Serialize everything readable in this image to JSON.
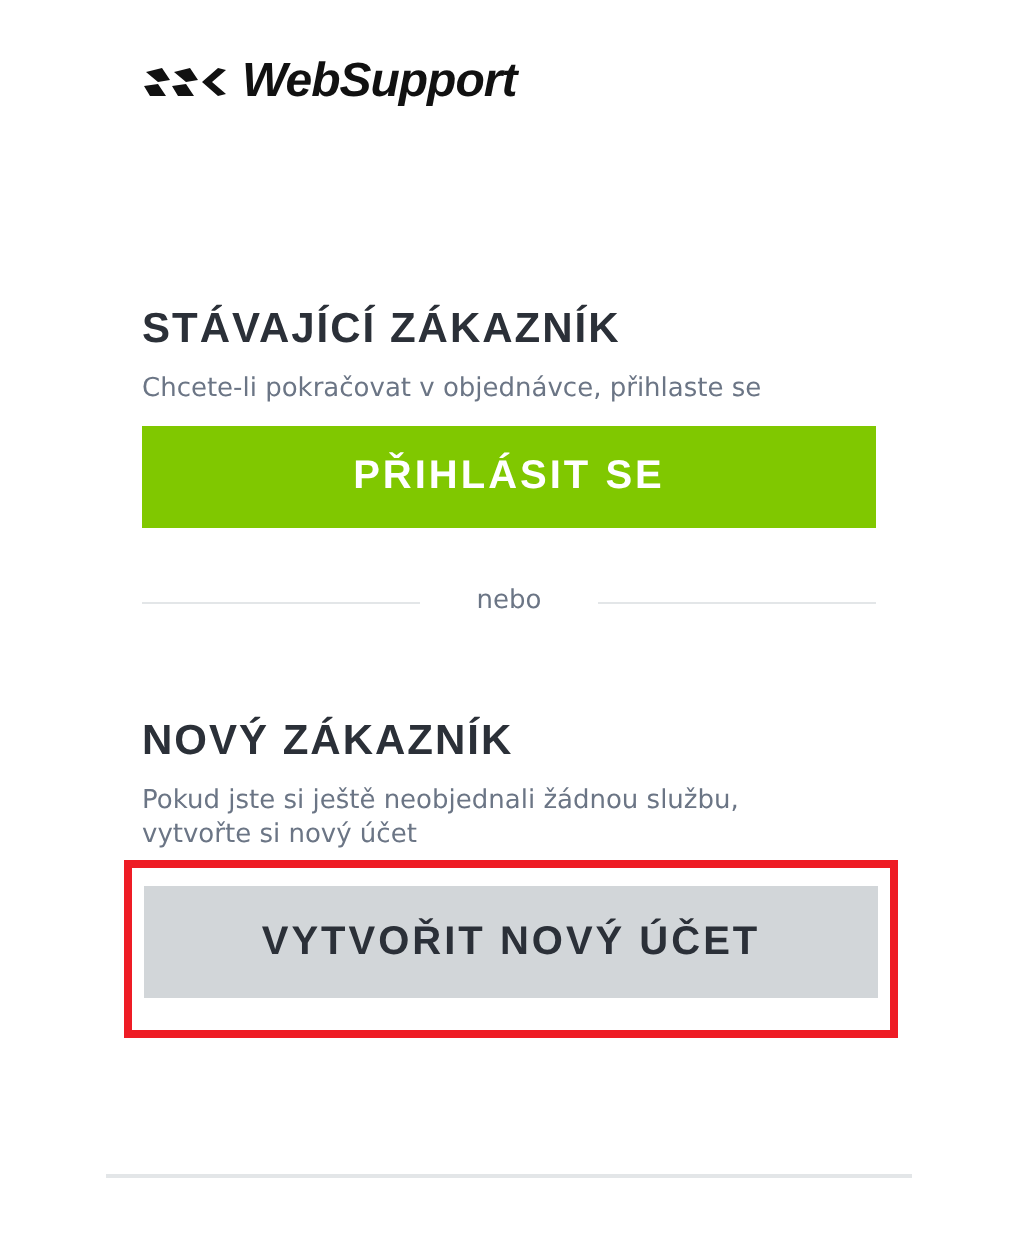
{
  "logo": {
    "text": "WebSupport"
  },
  "existing_customer": {
    "heading": "STÁVAJÍCÍ ZÁKAZNÍK",
    "text": "Chcete-li pokračovat v objednávce, přihlaste se",
    "button": {
      "label": "PŘIHLÁSIT SE",
      "kind": "primary",
      "highlighted": false
    }
  },
  "divider": {
    "text": "nebo"
  },
  "new_customer": {
    "heading": "NOVÝ ZÁKAZNÍK",
    "text": "Pokud jste si ještě neobjednali žádnou službu, vytvořte si nový účet",
    "button": {
      "label": "VYTVOŘIT NOVÝ ÚČET",
      "kind": "secondary",
      "highlighted": true
    }
  }
}
